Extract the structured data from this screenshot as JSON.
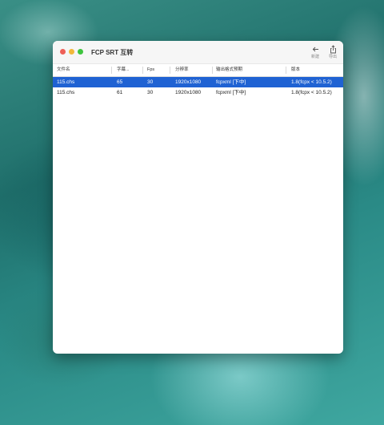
{
  "window": {
    "title": "FCP SRT 互转"
  },
  "toolbar": {
    "import_label": "新建",
    "export_label": "导出"
  },
  "table": {
    "columns": [
      "文件名",
      "字幕...",
      "Fps",
      "分辨率",
      "输出格式预期",
      "版本"
    ],
    "rows": [
      {
        "selected": true,
        "cells": [
          "115.chs",
          "65",
          "30",
          "1920x1080",
          "fcpxml [下中]",
          "1.8(fcpx < 10.5.2)"
        ]
      },
      {
        "selected": false,
        "cells": [
          "115.chs",
          "61",
          "30",
          "1920x1080",
          "fcpxml [下中]",
          "1.8(fcpx < 10.5.2)"
        ]
      }
    ]
  },
  "colors": {
    "selection": "#1f62d3",
    "accent": "#1f62d3"
  }
}
